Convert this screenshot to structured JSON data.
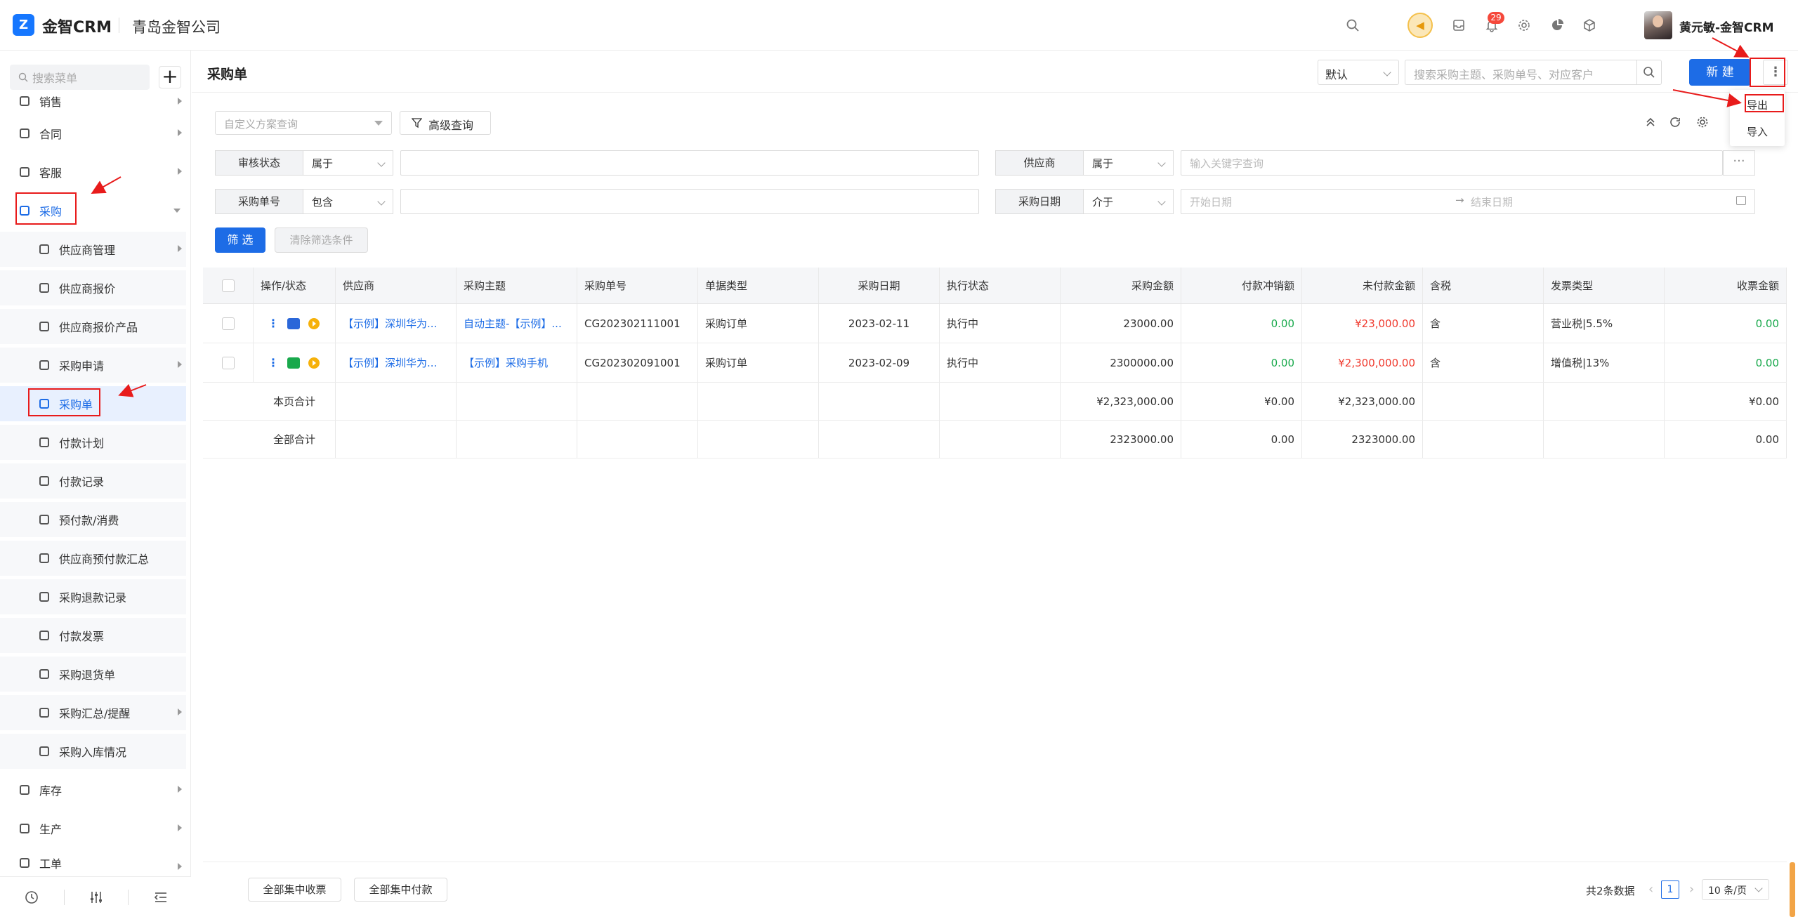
{
  "header": {
    "logo_mark": "Z",
    "app_name": "金智CRM",
    "company": "青岛金智公司",
    "notification_count": "29",
    "user_name": "黄元敏-金智CRM"
  },
  "sidebar": {
    "search_placeholder": "搜索菜单",
    "add_label": "+",
    "items": [
      {
        "label": "销售"
      },
      {
        "label": "合同"
      },
      {
        "label": "客服"
      },
      {
        "label": "采购"
      },
      {
        "label": "供应商管理"
      },
      {
        "label": "供应商报价"
      },
      {
        "label": "供应商报价产品"
      },
      {
        "label": "采购申请"
      },
      {
        "label": "采购单"
      },
      {
        "label": "付款计划"
      },
      {
        "label": "付款记录"
      },
      {
        "label": "预付款/消费"
      },
      {
        "label": "供应商预付款汇总"
      },
      {
        "label": "采购退款记录"
      },
      {
        "label": "付款发票"
      },
      {
        "label": "采购退货单"
      },
      {
        "label": "采购汇总/提醒"
      },
      {
        "label": "采购入库情况"
      },
      {
        "label": "库存"
      },
      {
        "label": "生产"
      },
      {
        "label": "工单"
      }
    ]
  },
  "titlebar": {
    "title": "采购单",
    "view_select": "默认",
    "search_placeholder": "搜索采购主题、采购单号、对应客户",
    "new_label": "新 建",
    "more_label": "⋮"
  },
  "dropdown": {
    "export_label": "导出",
    "import_label": "导入"
  },
  "filters": {
    "scheme_placeholder": "自定义方案查询",
    "advanced_label": "高级查询",
    "rows": [
      {
        "label": "审核状态",
        "op": "属于",
        "value": ""
      },
      {
        "label": "供应商",
        "op": "属于",
        "value": "输入关键字查询"
      },
      {
        "label": "采购单号",
        "op": "包含",
        "value": ""
      },
      {
        "label": "采购日期",
        "op": "介于",
        "start": "开始日期",
        "end": "结束日期"
      }
    ],
    "filter_btn": "筛 选",
    "clear_btn": "清除筛选条件"
  },
  "table": {
    "headers": [
      "操作/状态",
      "供应商",
      "采购主题",
      "采购单号",
      "单据类型",
      "采购日期",
      "执行状态",
      "采购金额",
      "付款冲销额",
      "未付款金额",
      "含税",
      "发票类型",
      "收票金额"
    ],
    "rows": [
      {
        "supplier": "【示例】深圳华为...",
        "subject": "自动主题-【示例】...",
        "order_no": "CG202302111001",
        "type": "采购订单",
        "date": "2023-02-11",
        "status": "执行中",
        "amount": "23000.00",
        "offset": "0.00",
        "unpaid": "¥23,000.00",
        "tax": "含",
        "invoice_type": "营业税|5.5%",
        "received": "0.00"
      },
      {
        "supplier": "【示例】深圳华为...",
        "subject": "【示例】采购手机",
        "order_no": "CG202302091001",
        "type": "采购订单",
        "date": "2023-02-09",
        "status": "执行中",
        "amount": "2300000.00",
        "offset": "0.00",
        "unpaid": "¥2,300,000.00",
        "tax": "含",
        "invoice_type": "增值税|13%",
        "received": "0.00"
      }
    ],
    "page_total": {
      "label": "本页合计",
      "amount": "¥2,323,000.00",
      "offset": "¥0.00",
      "unpaid": "¥2,323,000.00",
      "received": "¥0.00"
    },
    "all_total": {
      "label": "全部合计",
      "amount": "2323000.00",
      "offset": "0.00",
      "unpaid": "2323000.00",
      "received": "0.00"
    }
  },
  "footer": {
    "collect_all": "全部集中收票",
    "pay_all": "全部集中付款",
    "total_text": "共2条数据",
    "current_page": "1",
    "page_size": "10 条/页"
  },
  "colors": {
    "primary": "#1d6ce6",
    "annotation_red": "#e81b1b",
    "amount_green": "#19a94c",
    "amount_red": "#f03a2e"
  }
}
